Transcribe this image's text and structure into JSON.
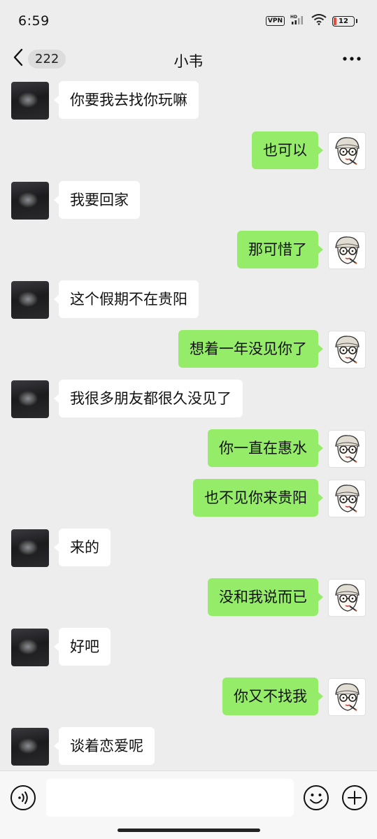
{
  "status_bar": {
    "time": "6:59",
    "vpn": "VPN",
    "battery_level": "12",
    "battery_color": "#e64b3c"
  },
  "nav": {
    "back_icon": "chevron-left-icon",
    "unread_count": "222",
    "title": "小韦",
    "more_icon": "more-horizontal-icon"
  },
  "messages": [
    {
      "side": "left",
      "text": "你要我去找你玩嘛"
    },
    {
      "side": "right",
      "text": "也可以"
    },
    {
      "side": "left",
      "text": "我要回家"
    },
    {
      "side": "right",
      "text": "那可惜了"
    },
    {
      "side": "left",
      "text": "这个假期不在贵阳"
    },
    {
      "side": "right",
      "text": "想着一年没见你了"
    },
    {
      "side": "left",
      "text": "我很多朋友都很久没见了"
    },
    {
      "side": "right",
      "text": "你一直在惠水"
    },
    {
      "side": "right",
      "text": "也不见你来贵阳"
    },
    {
      "side": "left",
      "text": "来的"
    },
    {
      "side": "right",
      "text": "没和我说而已"
    },
    {
      "side": "left",
      "text": "好吧"
    },
    {
      "side": "right",
      "text": "你又不找我"
    },
    {
      "side": "left",
      "text": "谈着恋爱呢"
    }
  ],
  "colors": {
    "self_bubble": "#95ec69",
    "friend_bubble": "#ffffff",
    "background": "#ededed"
  },
  "input_bar": {
    "voice_icon": "voice-icon",
    "input_value": "",
    "emoji_icon": "emoji-icon",
    "plus_icon": "plus-circle-icon"
  }
}
